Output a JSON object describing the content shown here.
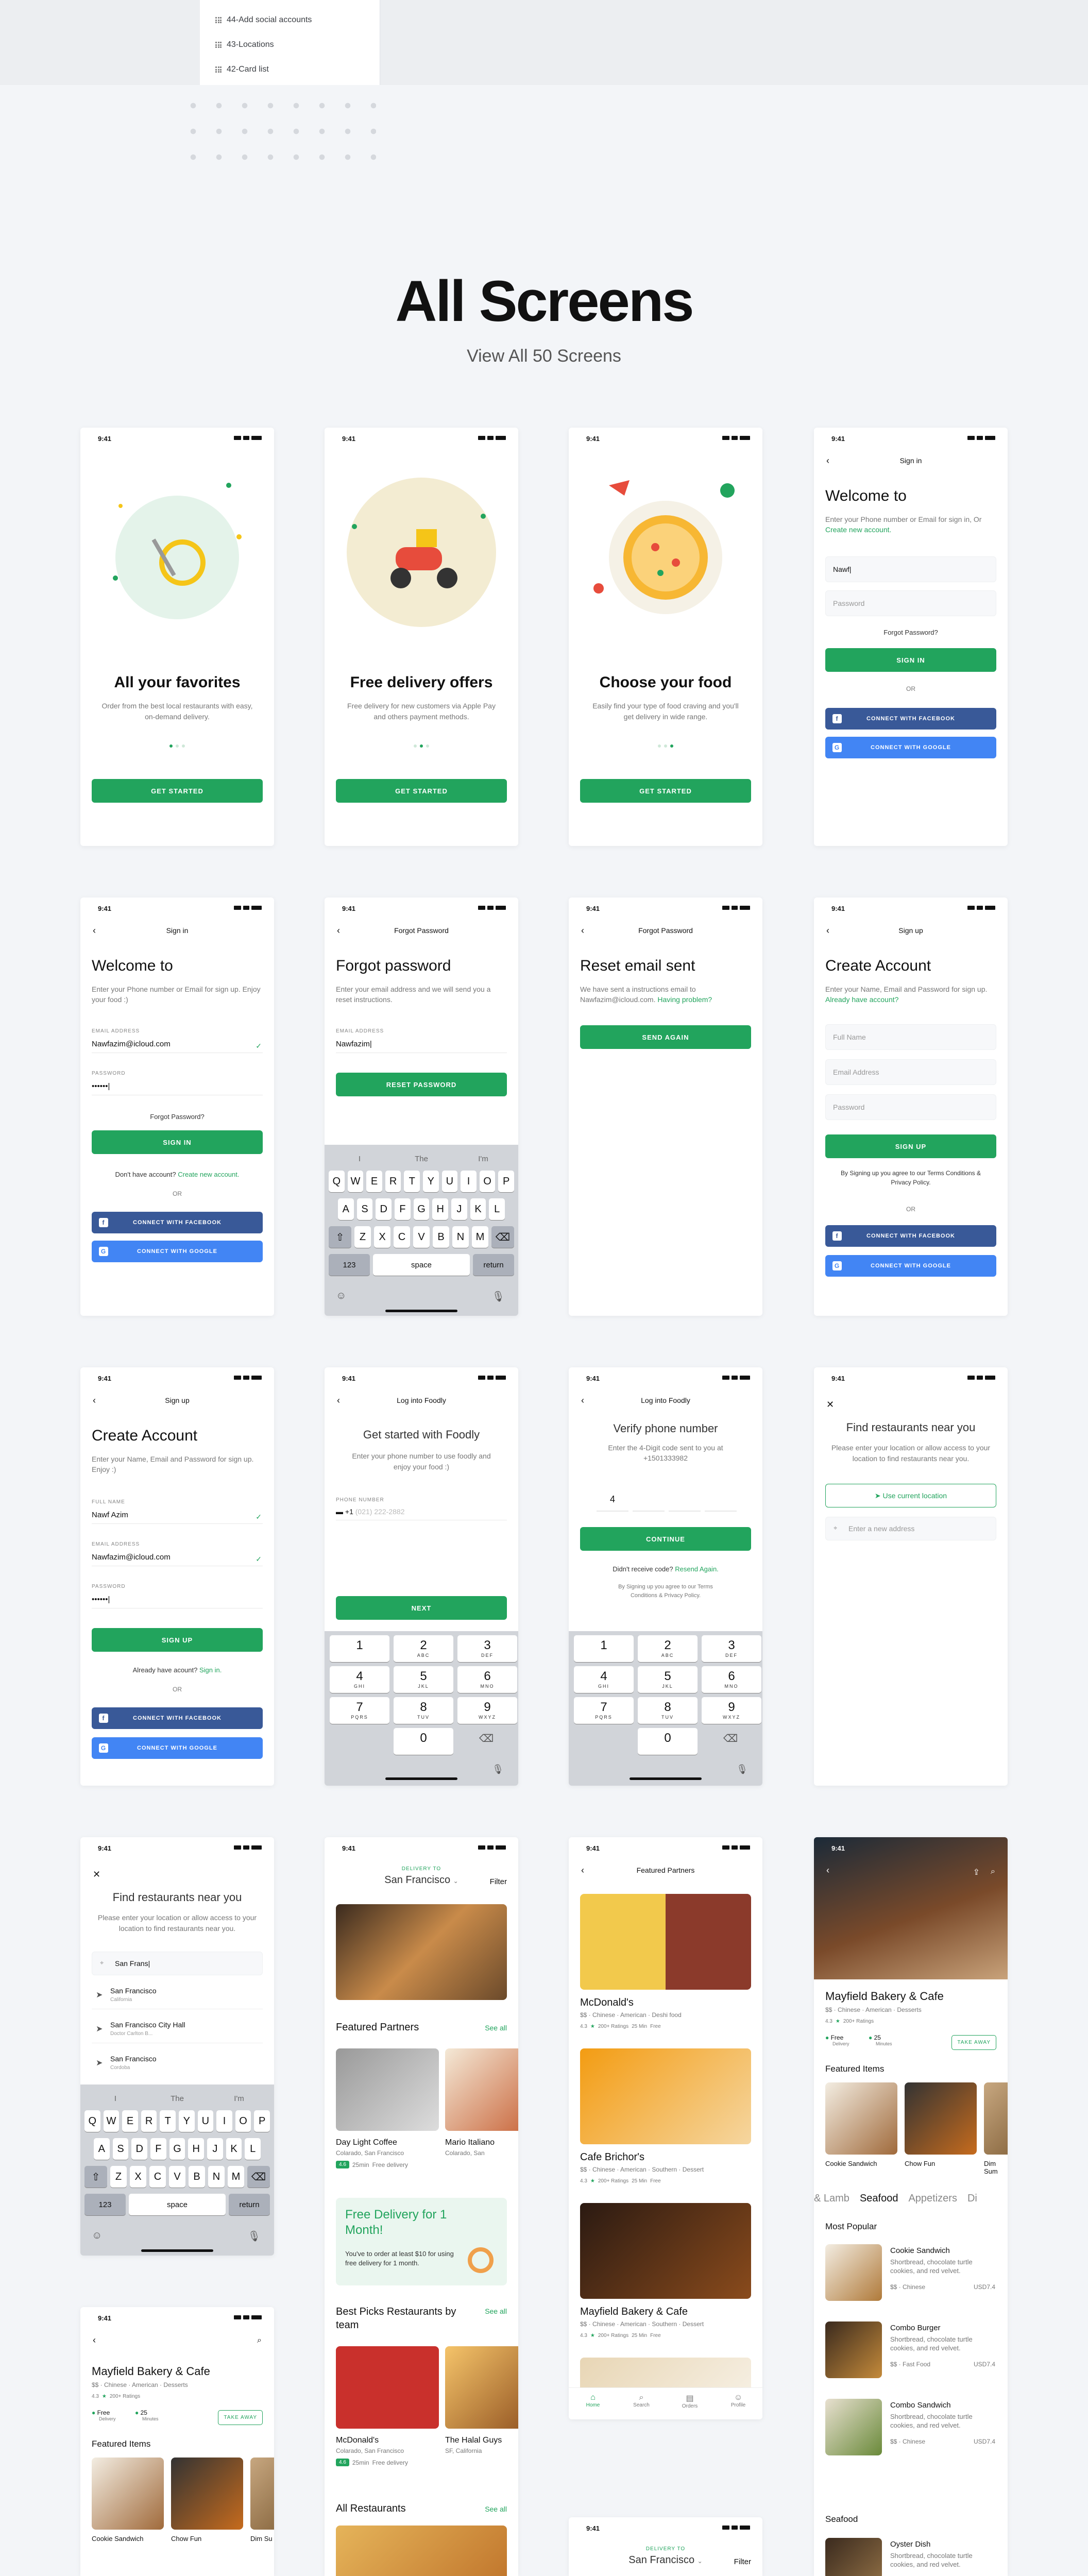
{
  "layers": [
    "44-Add social accounts",
    "43-Locations",
    "42-Card list"
  ],
  "hero": {
    "title": "All Screens",
    "subtitle": "View All 50 Screens"
  },
  "status_time": "9:41",
  "onboard": [
    {
      "title": "All your favorites",
      "desc": "Order from the best local restaurants with easy, on-demand delivery.",
      "btn": "GET STARTED"
    },
    {
      "title": "Free delivery offers",
      "desc": "Free delivery for new customers via Apple Pay and others payment methods.",
      "btn": "GET STARTED"
    },
    {
      "title": "Choose your food",
      "desc": "Easily find your type of food craving and you'll get delivery in wide range.",
      "btn": "GET STARTED"
    }
  ],
  "signin1": {
    "header": "Sign in",
    "title": "Welcome to",
    "desc": "Enter your Phone number or Email for sign in, Or",
    "desc_link": "Create new account.",
    "field1": "Nawf|",
    "field2": "Password",
    "forgot": "Forgot Password?",
    "btn": "SIGN IN",
    "or": "OR",
    "fb": "CONNECT WITH FACEBOOK",
    "google": "CONNECT WITH GOOGLE"
  },
  "signin2": {
    "header": "Sign in",
    "title": "Welcome to",
    "desc": "Enter your Phone number or Email for sign up. Enjoy your food :)",
    "email_label": "EMAIL ADDRESS",
    "email": "Nawfazim@icloud.com",
    "pw_label": "PASSWORD",
    "pw": "••••••|",
    "forgot": "Forgot Password?",
    "btn": "SIGN IN",
    "noacc": "Don't have account?",
    "create": "Create new account.",
    "or": "OR",
    "fb": "CONNECT WITH FACEBOOK",
    "google": "CONNECT WITH GOOGLE"
  },
  "forgot": {
    "header": "Forgot Password",
    "title": "Forgot password",
    "desc": "Enter your email address and we will send you a reset instructions.",
    "label": "EMAIL ADDRESS",
    "value": "Nawfazim|",
    "btn": "RESET PASSWORD"
  },
  "keyboard": {
    "sugg": [
      "I",
      "The",
      "I'm"
    ],
    "r1": [
      "Q",
      "W",
      "E",
      "R",
      "T",
      "Y",
      "U",
      "I",
      "O",
      "P"
    ],
    "r2": [
      "A",
      "S",
      "D",
      "F",
      "G",
      "H",
      "J",
      "K",
      "L"
    ],
    "r3": [
      "Z",
      "X",
      "C",
      "V",
      "B",
      "N",
      "M"
    ],
    "n123": "123",
    "space": "space",
    "ret": "return"
  },
  "reset": {
    "header": "Forgot Password",
    "title": "Reset email sent",
    "desc": "We have sent a instructions email to Nawfazim@icloud.com.",
    "link": "Having problem?",
    "btn": "SEND AGAIN"
  },
  "signup1": {
    "header": "Sign up",
    "title": "Create Account",
    "desc": "Enter your Name, Email and Password for sign up.",
    "link": "Already have account?",
    "f1": "Full Name",
    "f2": "Email Address",
    "f3": "Password",
    "btn": "SIGN UP",
    "terms": "By Signing up you agree to our Terms Conditions & Privacy Policy.",
    "or": "OR",
    "fb": "CONNECT WITH FACEBOOK",
    "google": "CONNECT WITH GOOGLE"
  },
  "signup2": {
    "header": "Sign up",
    "title": "Create Account",
    "desc": "Enter your Name, Email and Password for sign up. Enjoy :)",
    "l1": "FULL NAME",
    "v1": "Nawf Azim",
    "l2": "EMAIL ADDRESS",
    "v2": "Nawfazim@icloud.com",
    "l3": "PASSWORD",
    "v3": "••••••|",
    "btn": "SIGN UP",
    "already": "Already have acount?",
    "signin": "Sign in.",
    "or": "OR",
    "fb": "CONNECT WITH FACEBOOK",
    "google": "CONNECT WITH GOOGLE"
  },
  "login": {
    "header": "Log into Foodly",
    "title": "Get started with Foodly",
    "desc": "Enter your phone number to use foodly and enjoy your food :)",
    "label": "PHONE NUMBER",
    "code": "+1",
    "ph": "(021) 222-2882",
    "btn": "NEXT"
  },
  "numpad": [
    [
      "1",
      ""
    ],
    [
      "2",
      "ABC"
    ],
    [
      "3",
      "DEF"
    ],
    [
      "4",
      "GHI"
    ],
    [
      "5",
      "JKL"
    ],
    [
      "6",
      "MNO"
    ],
    [
      "7",
      "PQRS"
    ],
    [
      "8",
      "TUV"
    ],
    [
      "9",
      "WXYZ"
    ],
    [
      "0",
      ""
    ]
  ],
  "verify": {
    "header": "Log into Foodly",
    "title": "Verify phone number",
    "desc1": "Enter the 4-Digit code sent to you at",
    "phone": "+1501333982",
    "digit": "4",
    "btn": "CONTINUE",
    "noreceive": "Didn't receive code?",
    "resend": "Resend Again.",
    "terms": "By Signing up you agree to our Terms Conditions & Privacy Policy."
  },
  "loc1": {
    "title": "Find restaurants near you",
    "desc": "Please enter your location or allow access to your location to find restaurants near you.",
    "use": "Use current location",
    "ph": "Enter a new address"
  },
  "loc2": {
    "title": "Find restaurants near you",
    "desc": "Please enter your location or allow access to your location to find restaurants near you.",
    "query": "San Frans|",
    "results": [
      [
        "San Francisco",
        "California"
      ],
      [
        "San Francisco City Hall",
        "Doctor Carlton B..."
      ],
      [
        "San Francisco",
        "Cordoba"
      ]
    ]
  },
  "home": {
    "deliver_to": "DELIVERY TO",
    "city": "San Francisco",
    "filter": "Filter",
    "featured": "Featured Partners",
    "see_all": "See all",
    "p1": "Day Light Coffee",
    "p1loc": "Colarado, San Francisco",
    "p2": "Mario Italiano",
    "p2loc": "Colarado, San",
    "rating": "4.6",
    "time": "25min",
    "free": "Free delivery",
    "promo_title": "Free Delivery for 1 Month!",
    "promo_desc": "You've to order at least $10 for using free delivery for 1 month.",
    "best": "Best Picks Restaurants by team",
    "b1": "McDonald's",
    "b1loc": "Colarado, San Francisco",
    "b2": "The Halal Guys",
    "b2loc": "SF, California",
    "all": "All Restaurants"
  },
  "featured_list": {
    "header": "Featured Partners",
    "items": [
      {
        "name": "McDonald's",
        "cat": "$$ · Chinese · American · Deshi food",
        "rating": "4.3",
        "ratings": "200+ Ratings",
        "time": "25 Min",
        "free": "Free"
      },
      {
        "name": "Cafe Brichor's",
        "cat": "$$ · Chinese · American · Southern · Dessert",
        "rating": "4.3",
        "ratings": "200+ Ratings",
        "time": "25 Min",
        "free": "Free"
      },
      {
        "name": "Mayfield Bakery & Cafe",
        "cat": "$$ · Chinese · American · Southern · Dessert",
        "rating": "4.3",
        "ratings": "200+ Ratings",
        "time": "25 Min",
        "free": "Free"
      }
    ],
    "tabs": [
      "Home",
      "Search",
      "Orders",
      "Profile"
    ]
  },
  "detail": {
    "name": "Mayfield Bakery & Cafe",
    "cat": "$$ · Chinese · American · Desserts",
    "rating": "4.3",
    "ratings": "200+ Ratings",
    "free": "Free",
    "free_s": "Delivery",
    "time": "25",
    "time_s": "Minutes",
    "takeaway": "TAKE AWAY",
    "featured": "Featured Items",
    "f1": "Cookie Sandwich",
    "f2": "Chow Fun",
    "f3": "Dim Sum",
    "tabs": [
      "& Lamb",
      "Seafood",
      "Appetizers",
      "Di"
    ],
    "popular": "Most Popular",
    "items": [
      {
        "name": "Cookie Sandwich",
        "desc": "Shortbread, chocolate turtle cookies, and red velvet.",
        "meta": "$$ · Chinese",
        "price": "USD7.4"
      },
      {
        "name": "Combo Burger",
        "desc": "Shortbread, chocolate turtle cookies, and red velvet.",
        "meta": "$$ · Fast Food",
        "price": "USD7.4"
      },
      {
        "name": "Combo Sandwich",
        "desc": "Shortbread, chocolate turtle cookies, and red velvet.",
        "meta": "$$ · Chinese",
        "price": "USD7.4"
      }
    ],
    "seafood": "Seafood",
    "oyster": "Oyster Dish",
    "oyster_desc": "Shortbread, chocolate turtle cookies, and red velvet."
  },
  "detail2": {
    "name": "Mayfield Bakery & Cafe",
    "cat": "$$ · Chinese · American · Desserts",
    "rating": "4.3",
    "ratings": "200+ Ratings",
    "free": "Free",
    "free_s": "Delivery",
    "time": "25",
    "time_s": "Minutes",
    "takeaway": "TAKE AWAY",
    "featured": "Featured Items",
    "f1": "Cookie Sandwich",
    "f2": "Chow Fun",
    "f3": "Dim Su"
  },
  "home2": {
    "deliver_to": "DELIVERY TO",
    "city": "San Francisco",
    "filter": "Filter"
  },
  "colors": {
    "accent": "#22a45d",
    "facebook": "#395998",
    "google": "#4285f4"
  }
}
